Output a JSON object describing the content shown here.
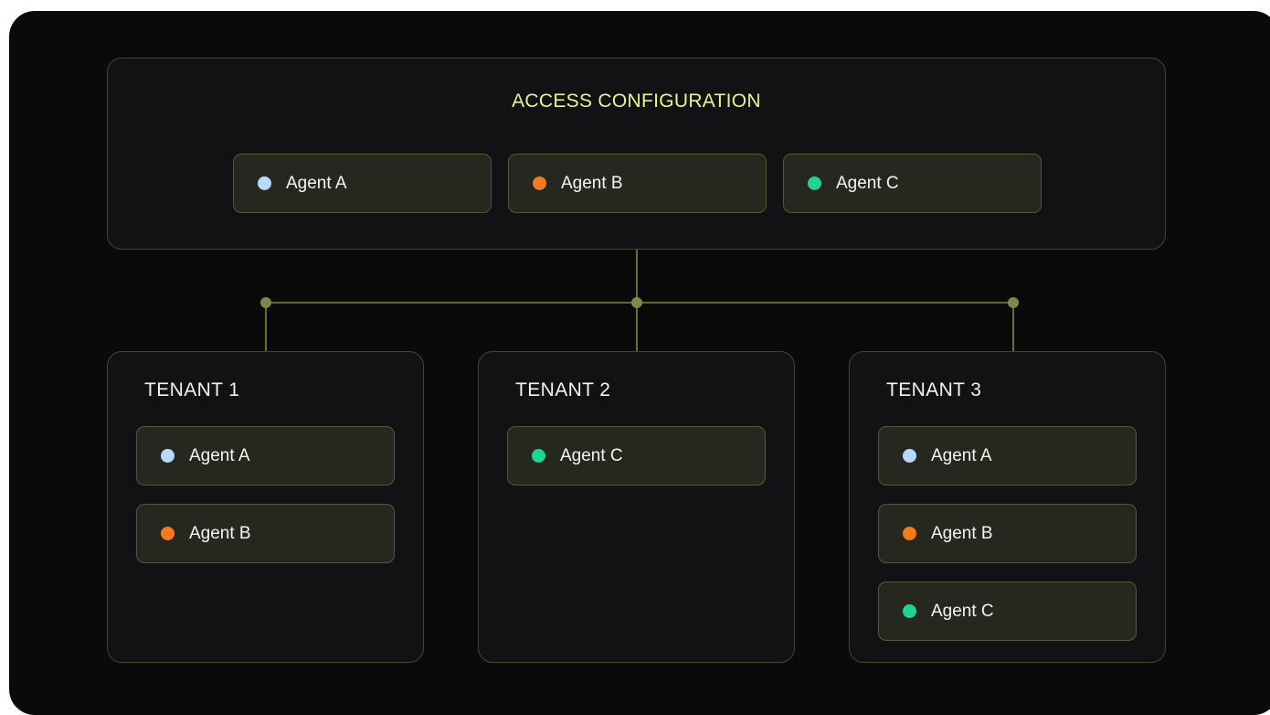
{
  "colors": {
    "agent_a": "#b7d9fb",
    "agent_b": "#f47a1f",
    "agent_c": "#1fd493",
    "title_accent": "#e2f78a",
    "connector": "#7a8a4c",
    "panel_border": "#3f4630",
    "card_border": "#505a35"
  },
  "access_configuration": {
    "title": "ACCESS CONFIGURATION",
    "agents": [
      {
        "label": "Agent A",
        "dot_color": "#b7d9fb"
      },
      {
        "label": "Agent B",
        "dot_color": "#f47a1f"
      },
      {
        "label": "Agent C",
        "dot_color": "#1fd493"
      }
    ]
  },
  "tenants": [
    {
      "title": "TENANT 1",
      "agents": [
        {
          "label": "Agent A",
          "dot_color": "#b7d9fb"
        },
        {
          "label": "Agent B",
          "dot_color": "#f47a1f"
        }
      ]
    },
    {
      "title": "TENANT 2",
      "agents": [
        {
          "label": "Agent C",
          "dot_color": "#1fd493"
        }
      ]
    },
    {
      "title": "TENANT 3",
      "agents": [
        {
          "label": "Agent A",
          "dot_color": "#b7d9fb"
        },
        {
          "label": "Agent B",
          "dot_color": "#f47a1f"
        },
        {
          "label": "Agent C",
          "dot_color": "#1fd493"
        }
      ]
    }
  ]
}
